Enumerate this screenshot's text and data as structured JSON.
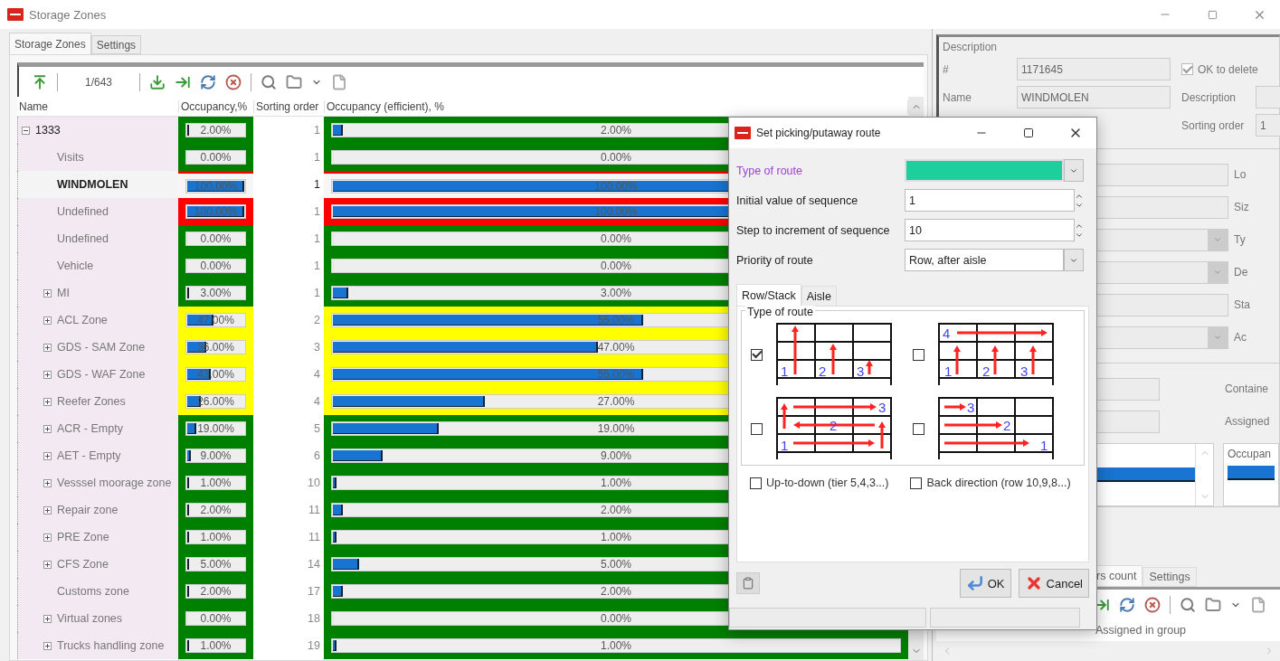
{
  "window": {
    "title": "Storage Zones"
  },
  "tabs": [
    {
      "label": "Storage Zones",
      "selected": true
    },
    {
      "label": "Settings",
      "selected": false
    }
  ],
  "toolbar": {
    "record_counter": "1/643"
  },
  "grid": {
    "columns": [
      "Name",
      "Occupancy,%",
      "Sorting order",
      "Occupancy (efficient), %"
    ],
    "tree": [
      {
        "name": "1333",
        "expanded": true,
        "selected": false,
        "color": "#008000",
        "occupancy": {
          "text": "2.00%",
          "level": 0.02
        },
        "sorting_order": "1",
        "efficient": {
          "text": "2.00%",
          "level": 0.02
        },
        "children": [
          {
            "name": "Visits",
            "selected": false,
            "color": "#008000",
            "occupancy": {
              "text": "0.00%",
              "level": 0
            },
            "sorting_order": "1",
            "efficient": {
              "text": "0.00%",
              "level": 0
            }
          },
          {
            "name": "WINDMOLEN",
            "selected": true,
            "color": "#ff0000",
            "occupancy": {
              "text": "100.00%",
              "level": 1
            },
            "sorting_order": "1",
            "efficient": {
              "text": "100.00%",
              "level": 1
            }
          },
          {
            "name": "Undefined",
            "selected": false,
            "color": "#ff0000",
            "occupancy": {
              "text": "100.00%",
              "level": 1
            },
            "sorting_order": "1",
            "efficient": {
              "text": "100.00%",
              "level": 1
            }
          },
          {
            "name": "Undefined",
            "selected": false,
            "color": "#008000",
            "occupancy": {
              "text": "0.00%",
              "level": 0
            },
            "sorting_order": "1",
            "efficient": {
              "text": "0.00%",
              "level": 0
            }
          },
          {
            "name": "Vehicle",
            "selected": false,
            "color": "#008000",
            "occupancy": {
              "text": "0.00%",
              "level": 0
            },
            "sorting_order": "1",
            "efficient": {
              "text": "0.00%",
              "level": 0
            }
          },
          {
            "name": "MI",
            "expanded": false,
            "selected": false,
            "color": "#008000",
            "occupancy": {
              "text": "3.00%",
              "level": 0.03
            },
            "sorting_order": "1",
            "efficient": {
              "text": "3.00%",
              "level": 0.03
            }
          },
          {
            "name": "ACL Zone",
            "expanded": false,
            "selected": false,
            "color": "#ffff00",
            "occupancy": {
              "text": "47.00%",
              "level": 0.47
            },
            "sorting_order": "2",
            "efficient": {
              "text": "55.00%",
              "level": 0.55
            }
          },
          {
            "name": "GDS - SAM Zone",
            "expanded": false,
            "selected": false,
            "color": "#ffff00",
            "occupancy": {
              "text": "36.00%",
              "level": 0.36
            },
            "sorting_order": "3",
            "efficient": {
              "text": "47.00%",
              "level": 0.47
            }
          },
          {
            "name": "GDS - WAF Zone",
            "expanded": false,
            "selected": false,
            "color": "#ffff00",
            "occupancy": {
              "text": "43.00%",
              "level": 0.43
            },
            "sorting_order": "4",
            "efficient": {
              "text": "55.00%",
              "level": 0.55
            }
          },
          {
            "name": "Reefer Zones",
            "expanded": false,
            "selected": false,
            "color": "#ffff00",
            "occupancy": {
              "text": "26.00%",
              "level": 0.26
            },
            "sorting_order": "4",
            "efficient": {
              "text": "27.00%",
              "level": 0.27
            }
          },
          {
            "name": "ACR - Empty",
            "expanded": false,
            "selected": false,
            "color": "#008000",
            "occupancy": {
              "text": "19.00%",
              "level": 0.19
            },
            "sorting_order": "5",
            "efficient": {
              "text": "19.00%",
              "level": 0.19
            }
          },
          {
            "name": "AET - Empty",
            "expanded": false,
            "selected": false,
            "color": "#008000",
            "occupancy": {
              "text": "9.00%",
              "level": 0.09
            },
            "sorting_order": "6",
            "efficient": {
              "text": "9.00%",
              "level": 0.09
            }
          },
          {
            "name": "Vesssel moorage zone",
            "expanded": false,
            "selected": false,
            "color": "#008000",
            "occupancy": {
              "text": "1.00%",
              "level": 0.01
            },
            "sorting_order": "10",
            "efficient": {
              "text": "1.00%",
              "level": 0.01
            }
          },
          {
            "name": "Repair zone",
            "expanded": false,
            "selected": false,
            "color": "#008000",
            "occupancy": {
              "text": "2.00%",
              "level": 0.02
            },
            "sorting_order": "11",
            "efficient": {
              "text": "2.00%",
              "level": 0.02
            }
          },
          {
            "name": "PRE Zone",
            "expanded": false,
            "selected": false,
            "color": "#008000",
            "occupancy": {
              "text": "1.00%",
              "level": 0.01
            },
            "sorting_order": "11",
            "efficient": {
              "text": "1.00%",
              "level": 0.01
            }
          },
          {
            "name": "CFS Zone",
            "expanded": false,
            "selected": false,
            "color": "#008000",
            "occupancy": {
              "text": "5.00%",
              "level": 0.05
            },
            "sorting_order": "14",
            "efficient": {
              "text": "5.00%",
              "level": 0.05
            }
          },
          {
            "name": "Customs zone",
            "selected": false,
            "color": "#008000",
            "occupancy": {
              "text": "2.00%",
              "level": 0.02
            },
            "sorting_order": "17",
            "efficient": {
              "text": "2.00%",
              "level": 0.02
            }
          },
          {
            "name": "Virtual zones",
            "expanded": false,
            "selected": false,
            "color": "#008000",
            "occupancy": {
              "text": "0.00%",
              "level": 0
            },
            "sorting_order": "18",
            "efficient": {
              "text": "0.00%",
              "level": 0
            }
          },
          {
            "name": "Trucks handling zone",
            "expanded": false,
            "selected": false,
            "color": "#008000",
            "occupancy": {
              "text": "1.00%",
              "level": 0.01
            },
            "sorting_order": "19",
            "efficient": {
              "text": "1.00%",
              "level": 0.01
            }
          }
        ]
      }
    ]
  },
  "details": {
    "group_title": "Description",
    "fields": [
      {
        "label": "#",
        "value": "1171645"
      },
      {
        "label": "Name",
        "value": "WINDMOLEN"
      }
    ],
    "ok_to_delete": {
      "label": "OK to delete",
      "checked": true
    },
    "description_label": "Description",
    "sorting_order": {
      "label": "Sorting order",
      "value": "1"
    },
    "side_fields": [
      {
        "label": "Lo",
        "kind": "text"
      },
      {
        "label": "Siz",
        "kind": "text"
      },
      {
        "label": "Ty",
        "kind": "combo"
      },
      {
        "label": "De",
        "kind": "combo"
      },
      {
        "label": "Sta",
        "kind": "text"
      },
      {
        "label": "Ac",
        "kind": "combo"
      }
    ],
    "lower_labels": [
      "Containe",
      "Assigned"
    ],
    "list_header": "Occupan",
    "bottom_tabs": [
      {
        "label": "rs count",
        "selected": true
      },
      {
        "label": "Settings",
        "selected": false
      }
    ],
    "assigned_header": "Assigned in group"
  },
  "dialog": {
    "title": "Set picking/putaway route",
    "fields": [
      {
        "kind": "color",
        "label": "Type of route",
        "color": "#1ccf9c"
      },
      {
        "kind": "spin",
        "label": "Initial value of sequence",
        "value": "1"
      },
      {
        "kind": "spin",
        "label": "Step to increment of sequence",
        "value": "10"
      },
      {
        "kind": "combo",
        "label": "Priority of route",
        "value": "Row, after aisle"
      }
    ],
    "tabs": [
      {
        "label": "Row/Stack",
        "selected": true
      },
      {
        "label": "Aisle",
        "selected": false
      }
    ],
    "group_title": "Type of route",
    "routes": [
      {
        "kind": "columns-up",
        "checked": true,
        "steps": [
          "1",
          "2",
          "3"
        ]
      },
      {
        "kind": "columns-then-top",
        "checked": false,
        "steps": [
          "4",
          "1",
          "2",
          "3"
        ]
      },
      {
        "kind": "snake",
        "checked": false,
        "steps": [
          "3",
          "2",
          "1"
        ]
      },
      {
        "kind": "rows-shrinking",
        "checked": false,
        "steps": [
          "3",
          "2",
          "1"
        ]
      }
    ],
    "options": [
      {
        "label": "Up-to-down (tier 5,4,3...)",
        "checked": false
      },
      {
        "label": "Back direction (row 10,9,8...)",
        "checked": false
      }
    ],
    "buttons": [
      {
        "kind": "ok",
        "label": "OK"
      },
      {
        "kind": "cancel",
        "label": "Cancel"
      }
    ]
  }
}
